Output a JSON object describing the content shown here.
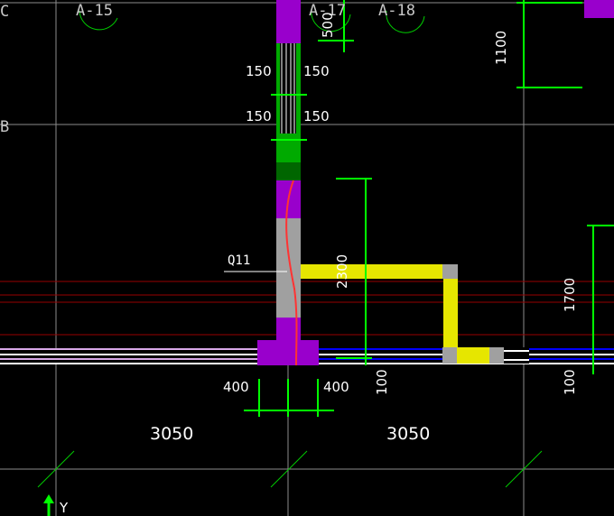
{
  "grid_labels": {
    "row_c": "C",
    "row_b": "B",
    "axis_15": "A-15",
    "axis_17": "A-17",
    "axis_18": "A-18"
  },
  "wall_tag": "Q11",
  "dimensions": {
    "top_500": "500",
    "right_1100": "1100",
    "left_150_upper": "150",
    "right_150_upper": "150",
    "left_150_lower": "150",
    "right_150_lower": "150",
    "vertical_2300": "2300",
    "right_1700": "1700",
    "bottom_100_mid": "100",
    "bottom_100_right": "100",
    "col_400_left": "400",
    "col_400_right": "400",
    "span_3050_left": "3050",
    "span_3050_right": "3050"
  },
  "ucs": {
    "y_label": "Y"
  },
  "colors": {
    "background": "#000000",
    "grid": "#8c8c8c",
    "dimension": "#00ff00",
    "column": "#9900cc",
    "beam_yellow": "#e6e600",
    "beam_blue": "#0000ff",
    "wall_gray": "#a0a0a0",
    "red_line": "#990000",
    "red_curve": "#ff3333"
  }
}
